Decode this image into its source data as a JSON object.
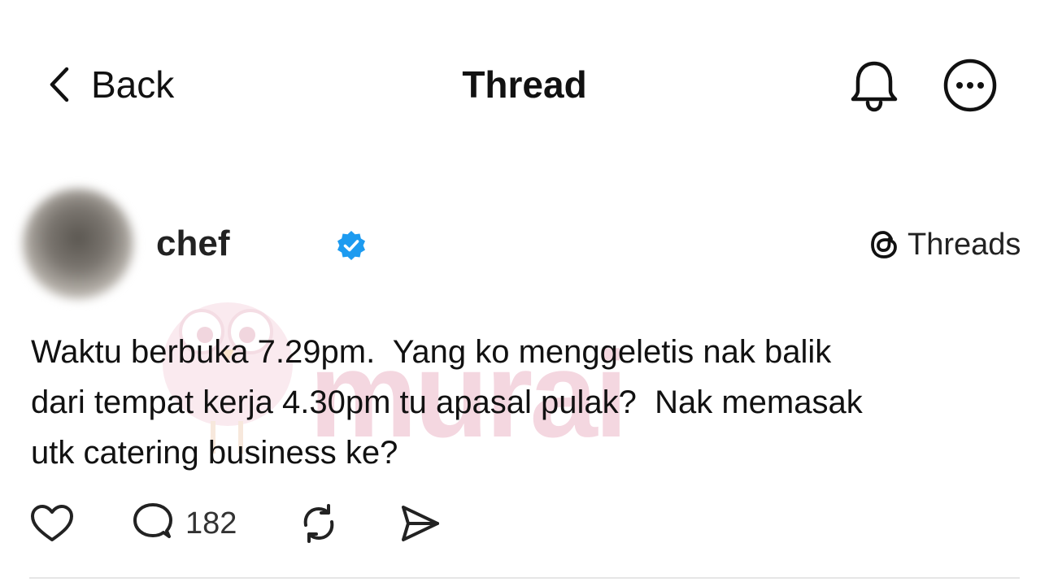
{
  "header": {
    "back_label": "Back",
    "title": "Thread"
  },
  "post": {
    "username": "chef",
    "platform_label": "Threads",
    "text": "Waktu berbuka 7.29pm.  Yang ko menggeletis nak balik\ndari tempat kerja 4.30pm tu apasal pulak?  Nak memasak\nutk catering business ke?",
    "reply_count": "182"
  },
  "watermark": {
    "text": "murai"
  },
  "icons": {
    "back": "chevron-left-icon",
    "notifications": "bell-icon",
    "more": "more-circle-icon",
    "verified": "verified-badge-icon",
    "platform": "threads-logo-icon",
    "like": "heart-icon",
    "reply": "comment-icon",
    "repost": "repost-icon",
    "share": "send-icon"
  },
  "colors": {
    "verified": "#1d9bf0",
    "text": "#111111",
    "watermark": "#f4d7e0"
  }
}
